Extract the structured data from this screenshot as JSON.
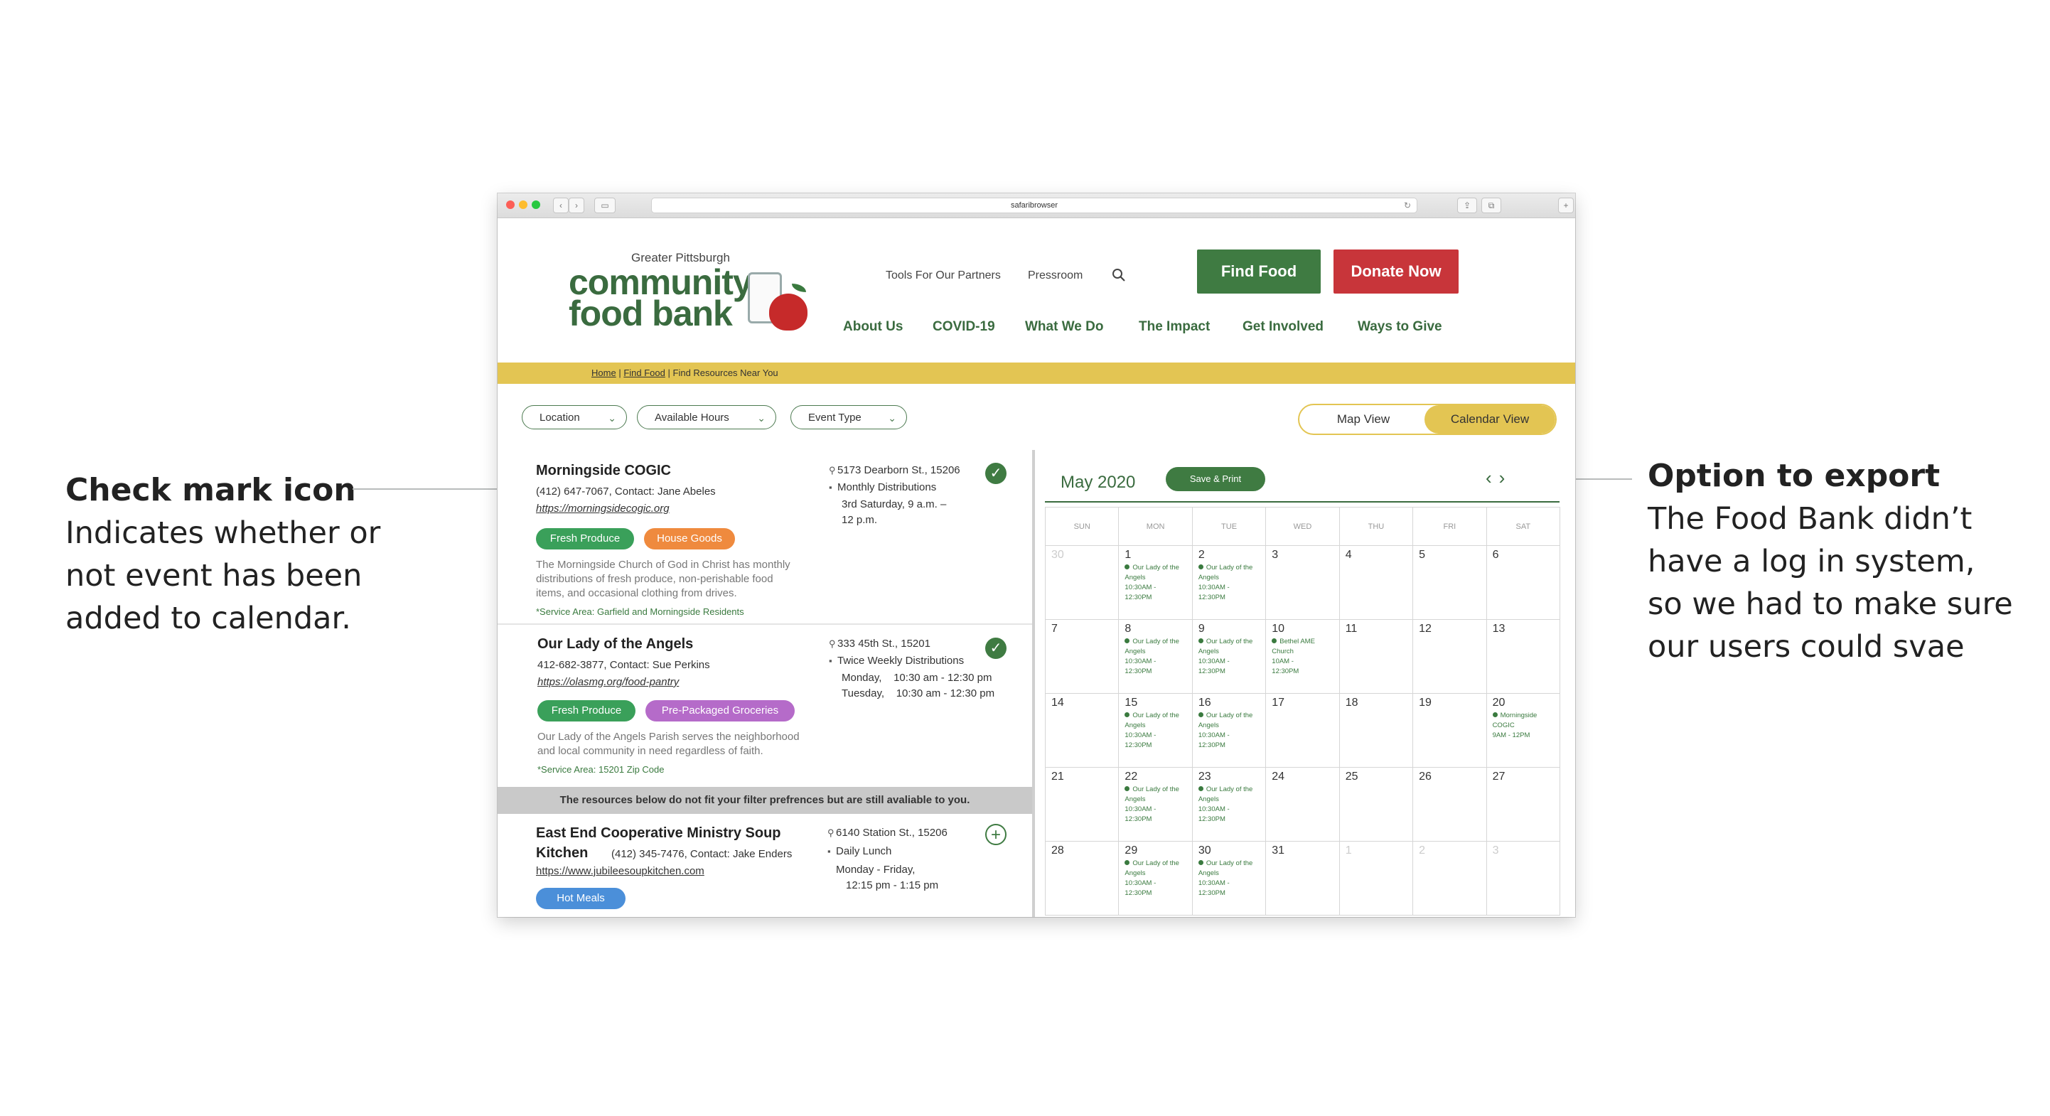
{
  "annotations": {
    "left": {
      "heading": "Check mark icon",
      "body": "Indicates whether or not event has been added to calendar."
    },
    "right": {
      "heading": "Option to export",
      "body": "The Food Bank didn’t have a log in system, so we had to make sure our users could svae"
    }
  },
  "browser": {
    "url": "safaribrowser"
  },
  "header": {
    "logo": {
      "small": "Greater Pittsburgh",
      "line1": "community",
      "line2": "food bank"
    },
    "top_links": [
      "Tools For Our Partners",
      "Pressroom"
    ],
    "nav": [
      "About Us",
      "COVID-19",
      "What We Do",
      "The Impact",
      "Get Involved",
      "Ways to Give"
    ],
    "find_food": "Find Food",
    "donate": "Donate Now"
  },
  "breadcrumb": {
    "home": "Home",
    "find": "Find Food",
    "current": "Find Resources Near You"
  },
  "filters": [
    "Location",
    "Available Hours",
    "Event Type"
  ],
  "view_toggle": {
    "map": "Map View",
    "calendar": "Calendar View",
    "active": "calendar"
  },
  "listings": [
    {
      "name": "Morningside COGIC",
      "contact": "(412) 647-7067, Contact: Jane Abeles",
      "url": "https://morningsidecogic.org",
      "address": "5173 Dearborn St., 15206",
      "schedule_type": "Monthly Distributions",
      "schedule": [
        "3rd Saturday, 9 a.m. –",
        "12 p.m."
      ],
      "tags": [
        "Fresh Produce",
        "House Goods"
      ],
      "description": [
        "The Morningside Church of God in Christ has monthly",
        "distributions of fresh produce, non-perishable food",
        "items, and occasional clothing from drives."
      ],
      "service_area": "*Service Area: Garfield and Morningside Residents",
      "added": true
    },
    {
      "name": "Our Lady of the Angels",
      "contact": "412-682-3877, Contact: Sue Perkins",
      "url": "https://olasmg.org/food-pantry",
      "address": "333 45th St., 15201",
      "schedule_type": "Twice Weekly Distributions",
      "schedule": [
        "Monday,    10:30 am - 12:30 pm",
        "Tuesday,    10:30 am - 12:30 pm"
      ],
      "tags": [
        "Fresh Produce",
        "Pre-Packaged Groceries"
      ],
      "description": [
        "Our Lady of the Angels Parish serves the neighborhood",
        "and local community in need regardless of faith."
      ],
      "service_area": "*Service Area: 15201 Zip Code",
      "added": true
    }
  ],
  "notice": "The resources below do not fit your filter prefrences but are still avaliable to you.",
  "other_listing": {
    "name_line1": "East End Cooperative Ministry Soup",
    "name_line2": "Kitchen",
    "contact": "(412) 345-7476, Contact: Jake Enders",
    "url": "https://www.jubileesoupkitchen.com",
    "address": "6140 Station St., 15206",
    "schedule_type": "Daily Lunch",
    "schedule": [
      "Monday - Friday,",
      "12:15 pm - 1:15 pm"
    ],
    "tags": [
      "Hot Meals"
    ],
    "added": false
  },
  "calendar": {
    "month": "May 2020",
    "save_print": "Save & Print",
    "days": [
      "SUN",
      "MON",
      "TUE",
      "WED",
      "THU",
      "FRI",
      "SAT"
    ],
    "weeks": [
      [
        {
          "d": "30",
          "dim": true
        },
        {
          "d": "1",
          "ev": [
            "Our Lady of the",
            "Angels",
            "10:30AM -",
            "12:30PM"
          ]
        },
        {
          "d": "2",
          "ev": [
            "Our Lady of the",
            "Angels",
            "10:30AM -",
            "12:30PM"
          ]
        },
        {
          "d": "3"
        },
        {
          "d": "4"
        },
        {
          "d": "5"
        },
        {
          "d": "6"
        }
      ],
      [
        {
          "d": "7"
        },
        {
          "d": "8",
          "ev": [
            "Our Lady of the",
            "Angels",
            "10:30AM -",
            "12:30PM"
          ]
        },
        {
          "d": "9",
          "ev": [
            "Our Lady of the",
            "Angels",
            "10:30AM -",
            "12:30PM"
          ]
        },
        {
          "d": "10",
          "ev": [
            "Bethel AME",
            "Church",
            "10AM -",
            "12:30PM"
          ]
        },
        {
          "d": "11"
        },
        {
          "d": "12"
        },
        {
          "d": "13"
        }
      ],
      [
        {
          "d": "14"
        },
        {
          "d": "15",
          "ev": [
            "Our Lady of the",
            "Angels",
            "10:30AM -",
            "12:30PM"
          ]
        },
        {
          "d": "16",
          "ev": [
            "Our Lady of the",
            "Angels",
            "10:30AM -",
            "12:30PM"
          ]
        },
        {
          "d": "17"
        },
        {
          "d": "18"
        },
        {
          "d": "19"
        },
        {
          "d": "20",
          "ev": [
            "Morningside",
            "COGIC",
            "9AM - 12PM"
          ]
        }
      ],
      [
        {
          "d": "21"
        },
        {
          "d": "22",
          "ev": [
            "Our Lady of the",
            "Angels",
            "10:30AM -",
            "12:30PM"
          ]
        },
        {
          "d": "23",
          "ev": [
            "Our Lady of the",
            "Angels",
            "10:30AM -",
            "12:30PM"
          ]
        },
        {
          "d": "24"
        },
        {
          "d": "25"
        },
        {
          "d": "26"
        },
        {
          "d": "27"
        }
      ],
      [
        {
          "d": "28"
        },
        {
          "d": "29",
          "ev": [
            "Our Lady of the",
            "Angels",
            "10:30AM -",
            "12:30PM"
          ]
        },
        {
          "d": "30",
          "ev": [
            "Our Lady of the",
            "Angels",
            "10:30AM -",
            "12:30PM"
          ]
        },
        {
          "d": "31"
        },
        {
          "d": "1",
          "dim": true
        },
        {
          "d": "2",
          "dim": true
        },
        {
          "d": "3",
          "dim": true
        }
      ]
    ]
  },
  "colors": {
    "green": "#3f7b42",
    "red": "#c8353a",
    "yellow": "#e3c553"
  }
}
